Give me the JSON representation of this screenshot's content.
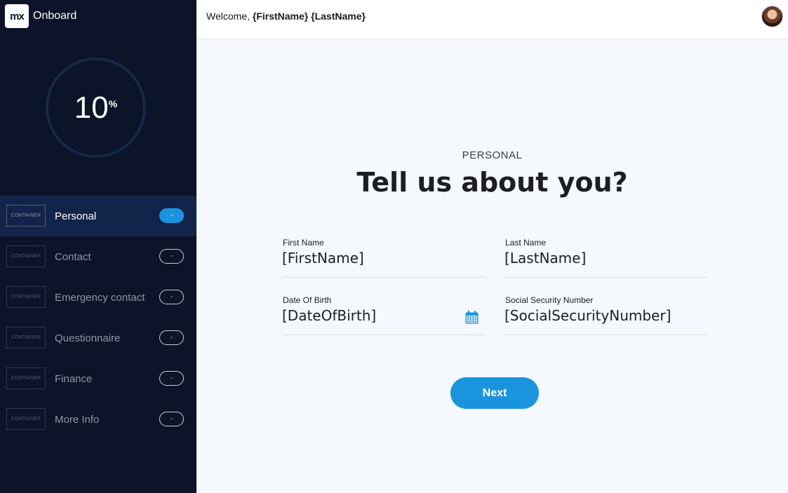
{
  "app": {
    "logo_text": "mx",
    "name": "Onboard"
  },
  "header": {
    "welcome_prefix": "Welcome, ",
    "welcome_name": "{FirstName} {LastName}"
  },
  "progress": {
    "value": "10",
    "unit": "%"
  },
  "steps": [
    {
      "container": "CONTAINER",
      "label": "Personal",
      "badge": "-",
      "active": true
    },
    {
      "container": "CONTAINER",
      "label": "Contact",
      "badge": "-",
      "active": false
    },
    {
      "container": "CONTAINER",
      "label": "Emergency contact",
      "badge": "-",
      "active": false
    },
    {
      "container": "CONTAINER",
      "label": "Questionnaire",
      "badge": "-",
      "active": false
    },
    {
      "container": "CONTAINER",
      "label": "Finance",
      "badge": "-",
      "active": false
    },
    {
      "container": "CONTAINER",
      "label": "More Info",
      "badge": "-",
      "active": false
    }
  ],
  "form": {
    "section": "PERSONAL",
    "heading": "Tell us about you?",
    "first_name": {
      "label": "First Name",
      "value": "[FirstName]"
    },
    "last_name": {
      "label": "Last Name",
      "value": "[LastName]"
    },
    "dob": {
      "label": "Date Of Birth",
      "value": "[DateOfBirth]"
    },
    "ssn": {
      "label": "Social Security Number",
      "value": "[SocialSecurityNumber]"
    },
    "next_label": "Next"
  },
  "colors": {
    "sidebar_bg": "#0b1428",
    "active_step_bg": "#12244a",
    "accent": "#1b94de",
    "main_bg": "#f5f8fc"
  }
}
